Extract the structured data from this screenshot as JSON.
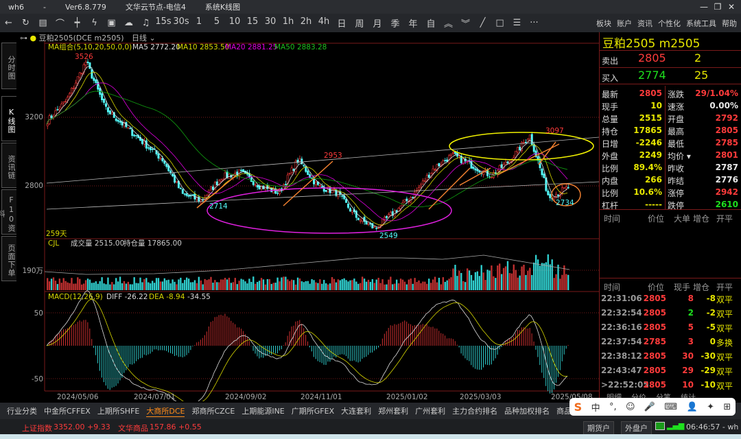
{
  "window": {
    "app": "wh6",
    "version": "Ver6.8.779",
    "server": "文华云节点-电信4",
    "view": "系统K线图"
  },
  "toolbar": {
    "periods": [
      "15s",
      "30s",
      "1",
      "5",
      "10",
      "15",
      "30",
      "1h",
      "2h",
      "4h",
      "日",
      "周",
      "月",
      "季",
      "年",
      "自"
    ],
    "menus": [
      "板块",
      "账户",
      "资讯",
      "个性化",
      "系统工具",
      "帮助"
    ]
  },
  "chart_header": {
    "symbol": "豆粕2505(DCE m2505)",
    "period": "日线"
  },
  "left_tabs": [
    "分时图",
    "K线图",
    "资讯链",
    "F10资料",
    "页面下单"
  ],
  "main": {
    "ma_label": "MA组合(5,10,20,50,0,0)",
    "ma5": "MA5 2772.20",
    "ma10": "MA10 2853.50",
    "ma20": "MA20 2881.25",
    "ma50": "MA50 2883.28",
    "days": "259天",
    "y_ticks": [
      "3200",
      "2800"
    ],
    "hi_label": "3526",
    "lo_label": "2549",
    "labels": [
      "2714",
      "2953",
      "3097",
      "2734"
    ]
  },
  "volume": {
    "label": "CJL",
    "vol": "成交量 2515.00",
    "oi": "持仓量 17865.00",
    "y_tick": "190万"
  },
  "macd": {
    "label": "MACD(12,26,9)",
    "diff": "DIFF -26.22",
    "dea": "DEA -8.94",
    "macd": "-34.55",
    "y_ticks": [
      "50",
      "-50"
    ]
  },
  "x_ticks": [
    "2024/05/06",
    "2024/07/01",
    "2024/09/02",
    "2024/11/01",
    "2025/01/02",
    "2025/03/03",
    "2025/05/08"
  ],
  "chart_data": {
    "type": "candlestick",
    "anchors": [
      3180,
      3300,
      3526,
      3250,
      3150,
      3050,
      2950,
      2750,
      2714,
      2850,
      2880,
      2800,
      2760,
      2953,
      2800,
      2760,
      2620,
      2549,
      2650,
      2750,
      2900,
      2980,
      2920,
      2860,
      2950,
      3097,
      2734,
      2790
    ]
  },
  "right": {
    "title": "豆粕2505  m2505",
    "sell": {
      "label": "卖出",
      "price": "2805",
      "qty": "2"
    },
    "buy": {
      "label": "买入",
      "price": "2774",
      "qty": "25"
    },
    "stats": [
      [
        "最新",
        "2805",
        "red",
        "涨跌",
        "29/1.04%",
        "red"
      ],
      [
        "现手",
        "10",
        "yel",
        "速涨",
        "0.00%",
        "wht"
      ],
      [
        "总量",
        "2515",
        "yel",
        "开盘",
        "2792",
        "red"
      ],
      [
        "持仓",
        "17865",
        "yel",
        "最高",
        "2805",
        "red"
      ],
      [
        "日增",
        "-2246",
        "yel",
        "最低",
        "2785",
        "red"
      ],
      [
        "外盘",
        "2249",
        "yel",
        "均价 ▾",
        "2801",
        "red"
      ],
      [
        "比例",
        "89.4%",
        "yel",
        "昨收",
        "2787",
        "wht"
      ],
      [
        "内盘",
        "266",
        "yel",
        "昨结",
        "2776",
        "wht"
      ],
      [
        "比例",
        "10.6%",
        "yel",
        "涨停",
        "2942",
        "red"
      ],
      [
        "杠杆",
        "-----",
        "yel",
        "跌停",
        "2610",
        "grn"
      ]
    ],
    "head1": [
      "时间",
      "价位",
      "大单",
      "增仓",
      "开平"
    ],
    "head2": [
      "时间",
      "价位",
      "现手",
      "增仓",
      "开平"
    ],
    "ticks": [
      [
        "22:31:06",
        "2805",
        "8",
        "red",
        "-8",
        "双平"
      ],
      [
        "22:32:54",
        "2805",
        "2",
        "grn",
        "-2",
        "双平"
      ],
      [
        "22:36:16",
        "2805",
        "5",
        "red",
        "-5",
        "双平"
      ],
      [
        "22:37:54",
        "2785",
        "3",
        "red",
        "0",
        "多换"
      ],
      [
        "22:38:12",
        "2805",
        "30",
        "red",
        "-30",
        "双平"
      ],
      [
        "22:43:47",
        "2805",
        "29",
        "red",
        "-29",
        "双平"
      ],
      [
        ">22:52:05",
        "2805",
        "10",
        "red",
        "-10",
        "双平"
      ]
    ],
    "subtabs": [
      "明细",
      "分价",
      "分笔",
      "统计"
    ]
  },
  "bottom_tabs": [
    "行业分类",
    "中金所CFFEX",
    "上期所SHFE",
    "大商所DCE",
    "郑商所CZCE",
    "上期能源INE",
    "广期所GFEX",
    "大连套利",
    "郑州套利",
    "广州套利",
    "主力合约排名",
    "品种加权排名",
    "商品分类指数"
  ],
  "status": {
    "idx1_name": "上证指数",
    "idx1": "3352.00  +9.33",
    "idx2_name": "文华商品",
    "idx2": "157.86  +0.55",
    "btn1": "期货户",
    "btn2": "外盘户",
    "clock": "06:46:57 - wh"
  },
  "ime": [
    "中",
    "°,",
    "☺",
    "🎤",
    "⌨",
    "👤",
    "✦",
    "⊞"
  ]
}
